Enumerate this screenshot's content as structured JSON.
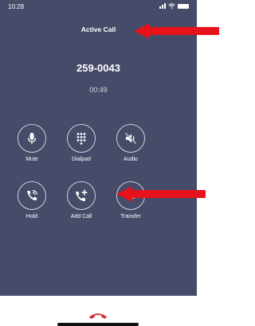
{
  "status_bar": {
    "time": "10:28"
  },
  "header": {
    "title": "Active Call"
  },
  "call": {
    "number": "259-0043",
    "duration": "00:49"
  },
  "controls": [
    {
      "label": "Mute",
      "icon": "microphone-icon"
    },
    {
      "label": "Dialpad",
      "icon": "dialpad-icon"
    },
    {
      "label": "Audio",
      "icon": "speaker-muted-icon"
    },
    {
      "label": "Hold",
      "icon": "phone-hold-icon"
    },
    {
      "label": "Add Call",
      "icon": "add-call-icon"
    },
    {
      "label": "Transfer",
      "icon": "transfer-icon"
    }
  ],
  "end_call": {
    "icon": "end-call-icon"
  },
  "colors": {
    "screen_background": "#454b68",
    "end_call": "#d9272e",
    "annotation_arrow": "#e8121b"
  }
}
